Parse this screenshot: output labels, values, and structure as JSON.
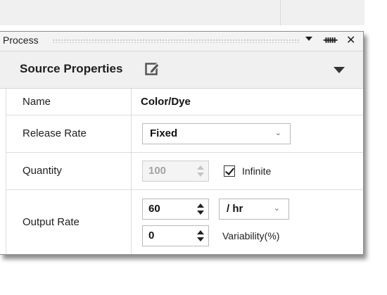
{
  "panel": {
    "title": "Process",
    "header_title": "Source Properties"
  },
  "props": {
    "name": {
      "label": "Name",
      "value": "Color/Dye"
    },
    "release_rate": {
      "label": "Release Rate",
      "value": "Fixed"
    },
    "quantity": {
      "label": "Quantity",
      "value": "100",
      "infinite_label": "Infinite",
      "infinite_checked": true
    },
    "output_rate": {
      "label": "Output Rate",
      "rate_value": "60",
      "unit": "/ hr",
      "variability_value": "0",
      "variability_label": "Variability(%)"
    }
  },
  "icons": {
    "dropdown": "dropdown-arrow-icon",
    "pin": "pin-icon",
    "close": "close-icon",
    "edit": "edit-icon",
    "collapse": "collapse-icon"
  }
}
